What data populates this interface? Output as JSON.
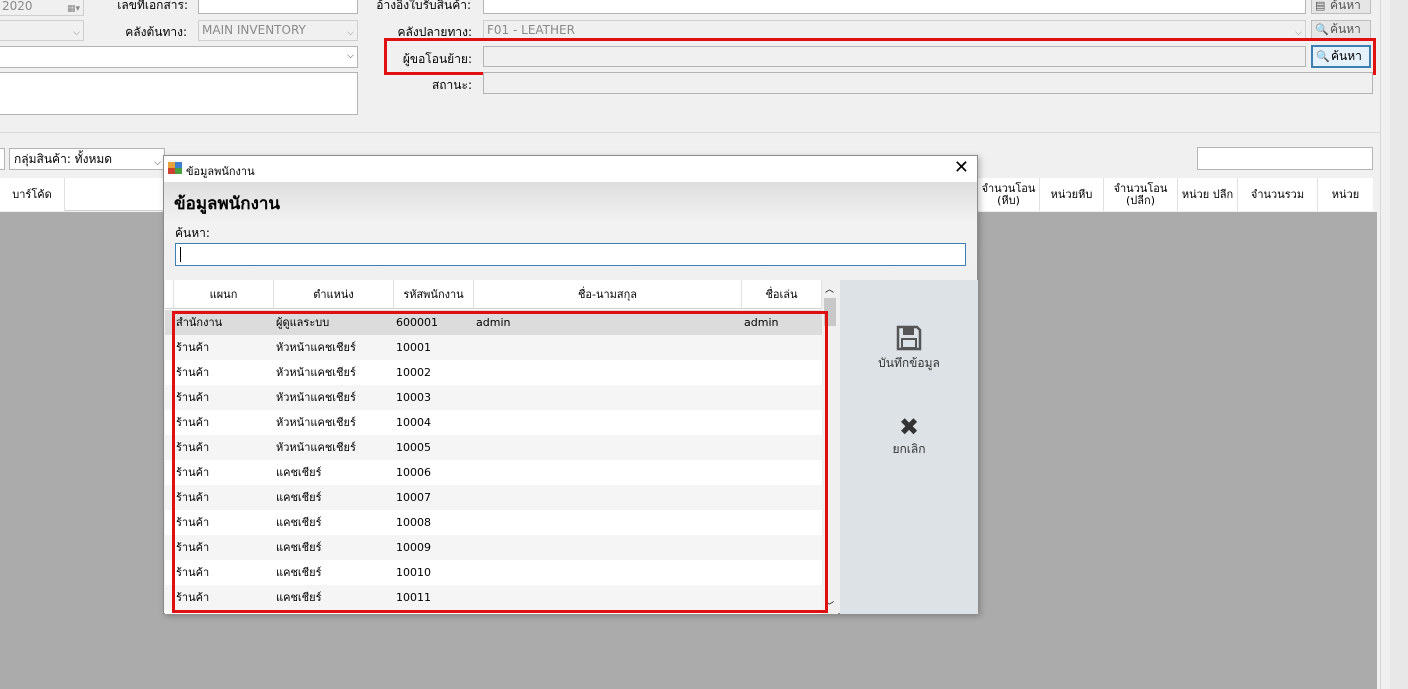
{
  "form": {
    "doc_date_value": "2020",
    "doc_no_label": "เลขที่เอกสาร:",
    "source_wh_label": "คลังต้นทาง:",
    "source_wh_value": "MAIN INVENTORY",
    "ref_label": "อ้างอิงใบรับสินค้า:",
    "dest_wh_label": "คลังปลายทาง:",
    "dest_wh_value": "F01 - LEATHER",
    "requester_label": "ผู้ขอโอนย้าย:",
    "status_label": "สถานะ:",
    "search_btn": "ค้นหา",
    "product_group_label": "กลุ่มสินค้า: ทั้งหมด"
  },
  "grid": {
    "headers": [
      "บาร์โค้ด",
      "จำนวนโอน (หีบ)",
      "หน่วยหีบ",
      "จำนวนโอน (ปลีก)",
      "หน่วย ปลีก",
      "จำนวนรวม",
      "หน่วย"
    ]
  },
  "dialog": {
    "window_title": "ข้อมูลพนักงาน",
    "heading": "ข้อมูลพนักงาน",
    "search_label": "ค้นหา:",
    "search_value": "",
    "columns": [
      "แผนก",
      "ตำแหน่ง",
      "รหัสพนักงาน",
      "ชื่อ-นามสกุล",
      "ชื่อเล่น"
    ],
    "rows": [
      [
        "สำนักงาน",
        "ผู้ดูแลระบบ",
        "600001",
        "admin",
        "admin"
      ],
      [
        "ร้านค้า",
        "หัวหน้าแคชเชียร์",
        "10001",
        "",
        ""
      ],
      [
        "ร้านค้า",
        "หัวหน้าแคชเชียร์",
        "10002",
        "",
        ""
      ],
      [
        "ร้านค้า",
        "หัวหน้าแคชเชียร์",
        "10003",
        "",
        ""
      ],
      [
        "ร้านค้า",
        "หัวหน้าแคชเชียร์",
        "10004",
        "",
        ""
      ],
      [
        "ร้านค้า",
        "หัวหน้าแคชเชียร์",
        "10005",
        "",
        ""
      ],
      [
        "ร้านค้า",
        "แคชเชียร์",
        "10006",
        "",
        ""
      ],
      [
        "ร้านค้า",
        "แคชเชียร์",
        "10007",
        "",
        ""
      ],
      [
        "ร้านค้า",
        "แคชเชียร์",
        "10008",
        "",
        ""
      ],
      [
        "ร้านค้า",
        "แคชเชียร์",
        "10009",
        "",
        ""
      ],
      [
        "ร้านค้า",
        "แคชเชียร์",
        "10010",
        "",
        ""
      ],
      [
        "ร้านค้า",
        "แคชเชียร์",
        "10011",
        "",
        ""
      ]
    ],
    "save_label": "บันทึกข้อมูล",
    "cancel_label": "ยกเลิก"
  },
  "colors": {
    "highlight": "#e01010",
    "focus_border": "#3c7fb1",
    "workspace": "#ababab"
  }
}
